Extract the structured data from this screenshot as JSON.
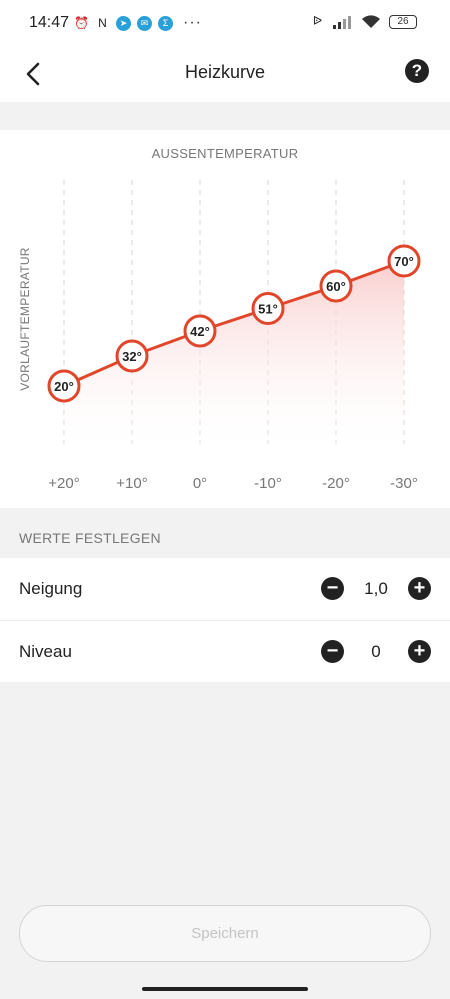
{
  "status": {
    "time": "14:47",
    "battery": "26",
    "more": "···"
  },
  "header": {
    "title": "Heizkurve",
    "back_icon": "chevron-left-icon",
    "help_icon": "question-circle-icon"
  },
  "colors": {
    "accent": "#e1462b",
    "fill": "#fde3e3"
  },
  "chart_data": {
    "type": "line",
    "xlabel": "AUSSENTEMPERATUR",
    "ylabel": "VORLAUFTEMPERATUR",
    "categories": [
      "+20°",
      "+10°",
      "0°",
      "-10°",
      "-20°",
      "-30°"
    ],
    "x": [
      20,
      10,
      0,
      -10,
      -20,
      -30
    ],
    "values": [
      20,
      32,
      42,
      51,
      60,
      70
    ],
    "point_labels": [
      "20°",
      "32°",
      "42°",
      "51°",
      "60°",
      "70°"
    ],
    "grid": "vertical-dashed",
    "area_fill": true
  },
  "settings": {
    "section_label": "WERTE FESTLEGEN",
    "rows": [
      {
        "label": "Neigung",
        "value": "1,0",
        "minus": "−",
        "plus": "+"
      },
      {
        "label": "Niveau",
        "value": "0",
        "minus": "−",
        "plus": "+"
      }
    ]
  },
  "save_label": "Speichern"
}
